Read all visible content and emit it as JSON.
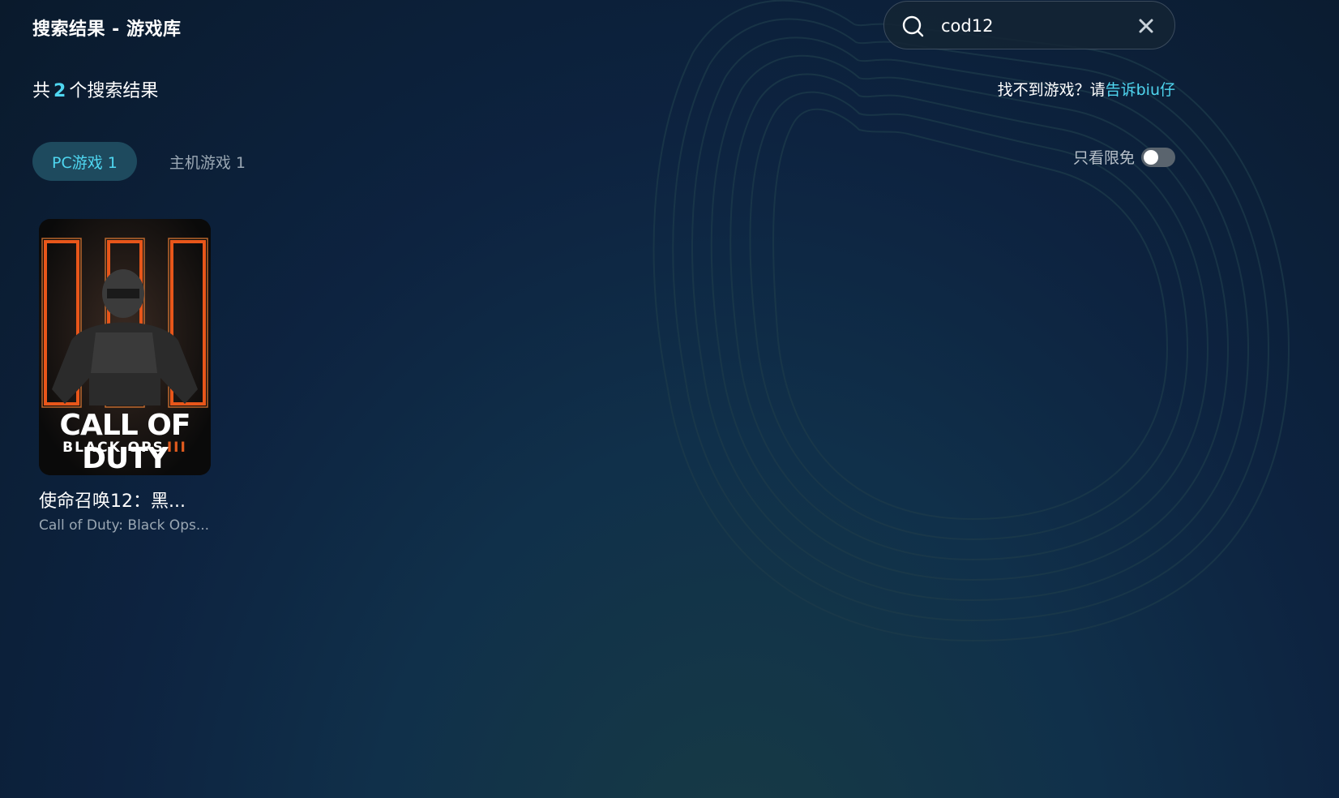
{
  "header": {
    "title": "搜索结果 - 游戏库"
  },
  "search": {
    "value": "cod12"
  },
  "results": {
    "prefix": "共",
    "count": "2",
    "suffix": "个搜索结果"
  },
  "feedback": {
    "text": "找不到游戏？请",
    "link": "告诉biu仔"
  },
  "tabs": [
    {
      "label": "PC游戏 1",
      "active": true
    },
    {
      "label": "主机游戏 1",
      "active": false
    }
  ],
  "filter": {
    "label": "只看限免",
    "enabled": false
  },
  "games": [
    {
      "name": "使命召唤12：黑...",
      "english_name": "Call of Duty: Black Ops...",
      "cover_title": "CALL OF DUTY",
      "cover_subtitle": "BLACK OPS",
      "cover_roman": "III"
    }
  ],
  "colors": {
    "accent": "#4fd6f0",
    "tab_active_bg": "#1e4a5e",
    "muted_text": "#9aa7b3"
  }
}
